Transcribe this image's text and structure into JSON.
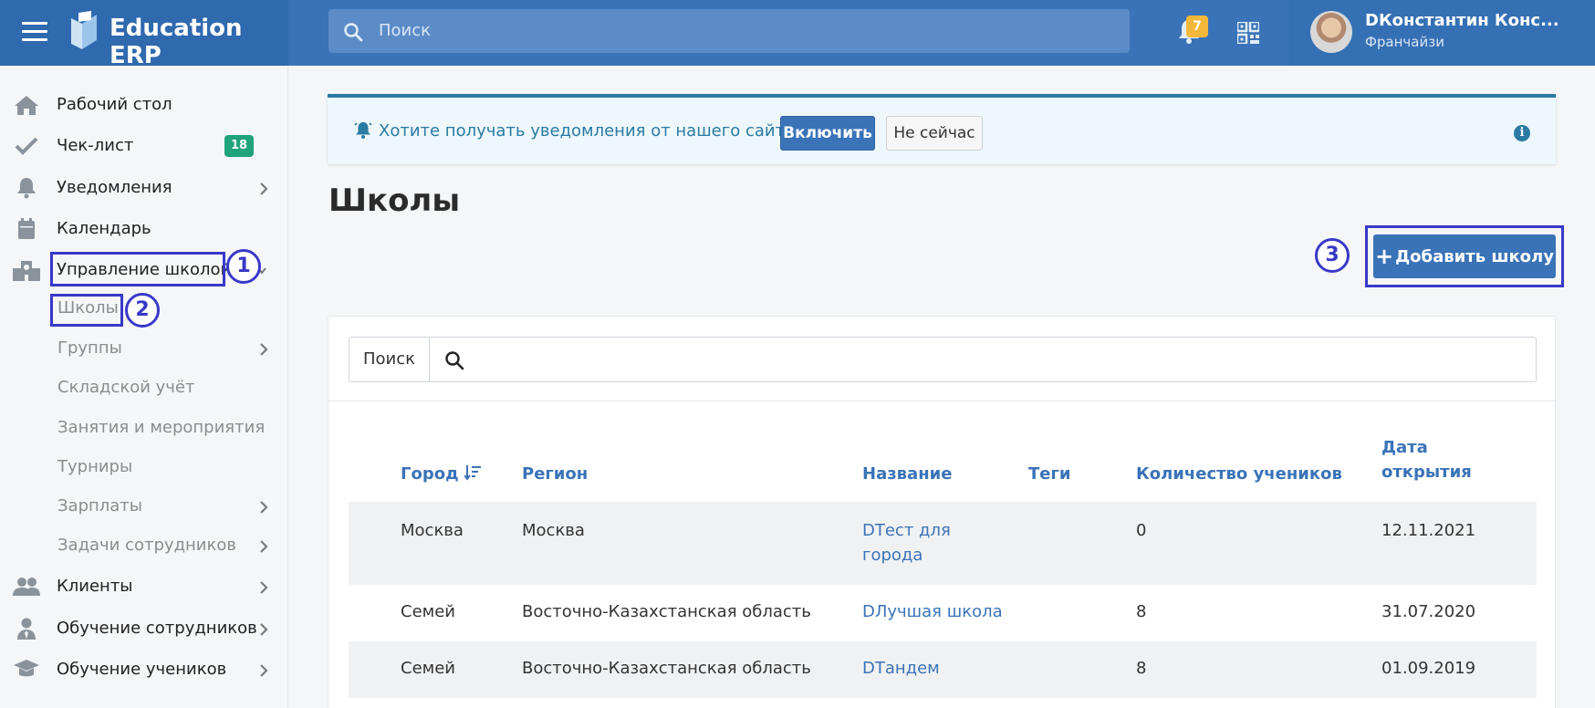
{
  "header": {
    "brand": "Education ERP",
    "search_placeholder": "Поиск",
    "notifications_count": "7",
    "user_name": "DКонстантин Конс...",
    "user_role": "Франчайзи",
    "colors": {
      "topbar": "#3a73b8",
      "brand_bg": "#2f69ae",
      "badge": "#f3b839"
    }
  },
  "sidebar": {
    "items": [
      {
        "label": "Рабочий стол",
        "icon": "home-icon"
      },
      {
        "label": "Чек-лист",
        "icon": "check-icon",
        "badge": "18"
      },
      {
        "label": "Уведомления",
        "icon": "bell-icon"
      },
      {
        "label": "Календарь",
        "icon": "calendar-icon"
      },
      {
        "label": "Управление школой",
        "icon": "school-icon"
      },
      {
        "label": "Клиенты",
        "icon": "users-icon"
      },
      {
        "label": "Обучение сотрудников",
        "icon": "user-tie-icon"
      },
      {
        "label": "Обучение учеников",
        "icon": "graduation-cap-icon"
      }
    ],
    "subitems": [
      {
        "label": "Школы"
      },
      {
        "label": "Группы"
      },
      {
        "label": "Складской учёт"
      },
      {
        "label": "Занятия и мероприятия"
      },
      {
        "label": "Турниры"
      },
      {
        "label": "Зарплаты"
      },
      {
        "label": "Задачи сотрудников"
      }
    ]
  },
  "annotations": {
    "one": "1",
    "two": "2",
    "three": "3"
  },
  "notice": {
    "text": "Хотите получать уведомления от нашего сайта?",
    "enable_label": "Включить",
    "later_label": "Не сейчас"
  },
  "page": {
    "title": "Школы",
    "add_label": "Добавить школу",
    "search_button": "Поиск"
  },
  "table": {
    "columns": [
      "Город",
      "Регион",
      "Название",
      "Теги",
      "Количество учеников",
      "Дата",
      "открытия"
    ],
    "rows": [
      {
        "city": "Москва",
        "region": "Москва",
        "name_line1": "DТест для",
        "name_line2": "города",
        "tags": "",
        "students": "0",
        "date": "12.11.2021"
      },
      {
        "city": "Семей",
        "region": "Восточно-Казахстанская область",
        "name_line1": "DЛучшая школа",
        "tags": "",
        "students": "8",
        "date": "31.07.2020"
      },
      {
        "city": "Семей",
        "region": "Восточно-Казахстанская область",
        "name_line1": "DТандем",
        "tags": "",
        "students": "8",
        "date": "01.09.2019"
      }
    ]
  }
}
